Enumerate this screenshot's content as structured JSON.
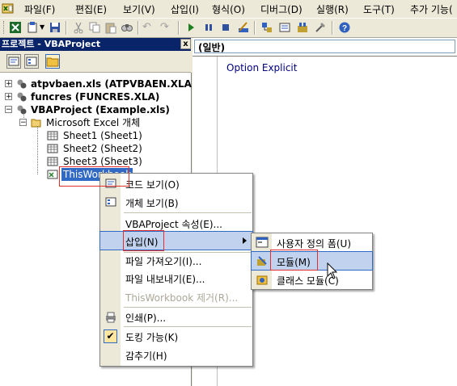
{
  "menubar": {
    "items": [
      {
        "label": "파일(F)"
      },
      {
        "label": "편집(E)"
      },
      {
        "label": "보기(V)"
      },
      {
        "label": "삽입(I)"
      },
      {
        "label": "형식(O)"
      },
      {
        "label": "디버그(D)"
      },
      {
        "label": "실행(R)"
      },
      {
        "label": "도구(T)"
      },
      {
        "label": "추가 기능("
      }
    ]
  },
  "project": {
    "title": "프로젝트 - VBAProject",
    "close": "x",
    "tree": [
      {
        "label": "atpvbaen.xls (ATPVBAEN.XLA)"
      },
      {
        "label": "funcres (FUNCRES.XLA)"
      },
      {
        "label": "VBAProject (Example.xls)"
      },
      {
        "label": "Microsoft Excel 개체"
      },
      {
        "label": "Sheet1 (Sheet1)"
      },
      {
        "label": "Sheet2 (Sheet2)"
      },
      {
        "label": "Sheet3 (Sheet3)"
      },
      {
        "label": "ThisWorkbook"
      }
    ]
  },
  "code": {
    "object_dropdown": "(일반)",
    "line1": "Option Explicit"
  },
  "context_menu": {
    "items": [
      {
        "label": "코드 보기(O)"
      },
      {
        "label": "개체 보기(B)"
      },
      {
        "label": "VBAProject 속성(E)..."
      },
      {
        "label": "삽입(N)"
      },
      {
        "label": "파일 가져오기(I)..."
      },
      {
        "label": "파일 내보내기(E)..."
      },
      {
        "label": "ThisWorkbook 제거(R)..."
      },
      {
        "label": "인쇄(P)..."
      },
      {
        "label": "도킹 가능(K)"
      },
      {
        "label": "감추기(H)"
      }
    ]
  },
  "submenu": {
    "items": [
      {
        "label": "사용자 정의 폼(U)"
      },
      {
        "label": "모듈(M)"
      },
      {
        "label": "클래스 모듈(C)"
      }
    ]
  },
  "colors": {
    "title_bar": "#0a246a",
    "highlight": "#c1d2ee",
    "annotation": "#e03030"
  }
}
